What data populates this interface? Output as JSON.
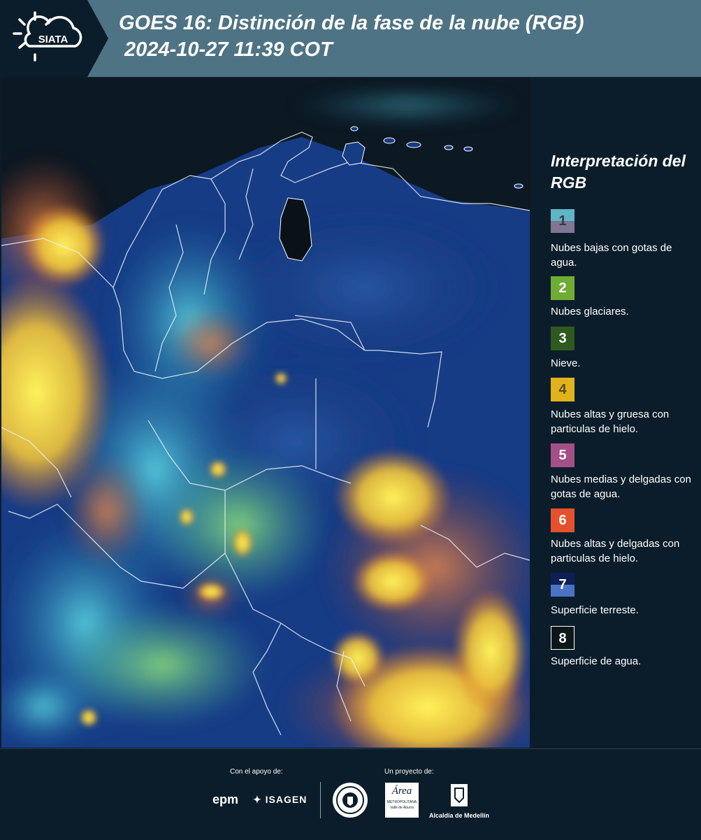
{
  "header": {
    "logo_text": "SIATA",
    "title": "GOES 16: Distinción de la fase de la nube (RGB)\n 2024-10-27 11:39 COT"
  },
  "legend": {
    "title": "Interpretación del RGB",
    "items": [
      {
        "number": "1",
        "label": "Nubes bajas con gotas de agua.",
        "color_top": "#5fb5c4",
        "color_bottom": "#7e7694",
        "text_color": "#3a3a4a"
      },
      {
        "number": "2",
        "label": "Nubes glaciares.",
        "color_top": "#6eac34",
        "color_bottom": "#6eac34",
        "text_color": "#ffffff"
      },
      {
        "number": "3",
        "label": "Nieve.",
        "color_top": "#2e5a1e",
        "color_bottom": "#2e5a1e",
        "text_color": "#ffffff"
      },
      {
        "number": "4",
        "label": "Nubes altas y gruesa con particulas de hielo.",
        "color_top": "#e2b21c",
        "color_bottom": "#e2b21c",
        "text_color": "#5a4a20"
      },
      {
        "number": "5",
        "label": "Nubes medias y delgadas con gotas de agua.",
        "color_top": "#a44f86",
        "color_bottom": "#a44f86",
        "text_color": "#ffffff"
      },
      {
        "number": "6",
        "label": "Nubes altas y delgadas con particulas de hielo.",
        "color_top": "#e4512c",
        "color_bottom": "#e4512c",
        "text_color": "#ffffff"
      },
      {
        "number": "7",
        "label": "Superficie terreste.",
        "color_top": "#0e1f58",
        "color_bottom": "#4a73c6",
        "text_color": "#ffffff"
      },
      {
        "number": "8",
        "label": "Superficie de agua.",
        "color_top": "#0b1616",
        "color_bottom": "#0b1616",
        "text_color": "#ffffff"
      }
    ]
  },
  "footer": {
    "support_label": "Con el apoyo de:",
    "project_label": "Un proyecto de:",
    "epm": "epm",
    "isagen": "ISAGEN",
    "area_main": "Área",
    "area_sub1": "METROPOLITANA",
    "area_sub2": "Valle de Aburrá",
    "alcaldia": "Alcaldía de Medellín"
  }
}
